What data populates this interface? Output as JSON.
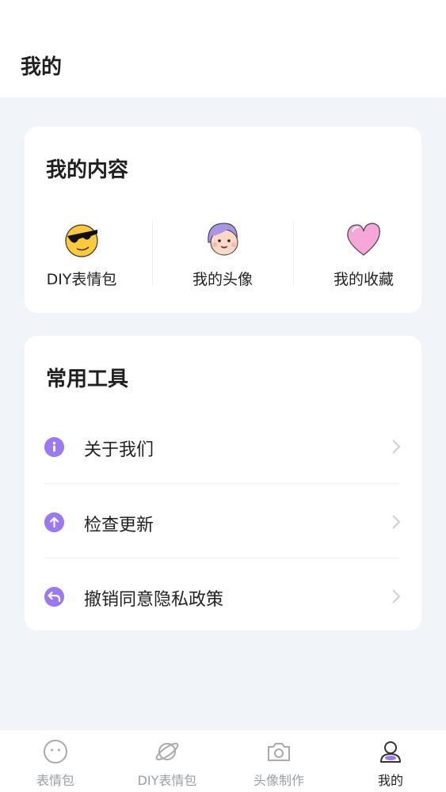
{
  "header": {
    "title": "我的"
  },
  "my_content": {
    "title": "我的内容",
    "items": [
      {
        "label": "DIY表情包",
        "icon": "cool-sunglasses-emoji-icon"
      },
      {
        "label": "我的头像",
        "icon": "cartoon-avatar-icon"
      },
      {
        "label": "我的收藏",
        "icon": "pink-heart-icon"
      }
    ]
  },
  "tools": {
    "title": "常用工具",
    "items": [
      {
        "label": "关于我们",
        "icon": "info-icon"
      },
      {
        "label": "检查更新",
        "icon": "upload-arrow-icon"
      },
      {
        "label": "撤销同意隐私政策",
        "icon": "undo-arrow-icon"
      }
    ]
  },
  "tabbar": {
    "items": [
      {
        "label": "表情包",
        "icon": "smiley-face-icon",
        "active": false
      },
      {
        "label": "DIY表情包",
        "icon": "planet-icon",
        "active": false
      },
      {
        "label": "头像制作",
        "icon": "camera-icon",
        "active": false
      },
      {
        "label": "我的",
        "icon": "user-profile-icon",
        "active": true
      }
    ]
  },
  "colors": {
    "accent": "#9b79f3",
    "background": "#f1f5f9",
    "card": "#ffffff",
    "inactive_tab": "#9aa0a6"
  }
}
